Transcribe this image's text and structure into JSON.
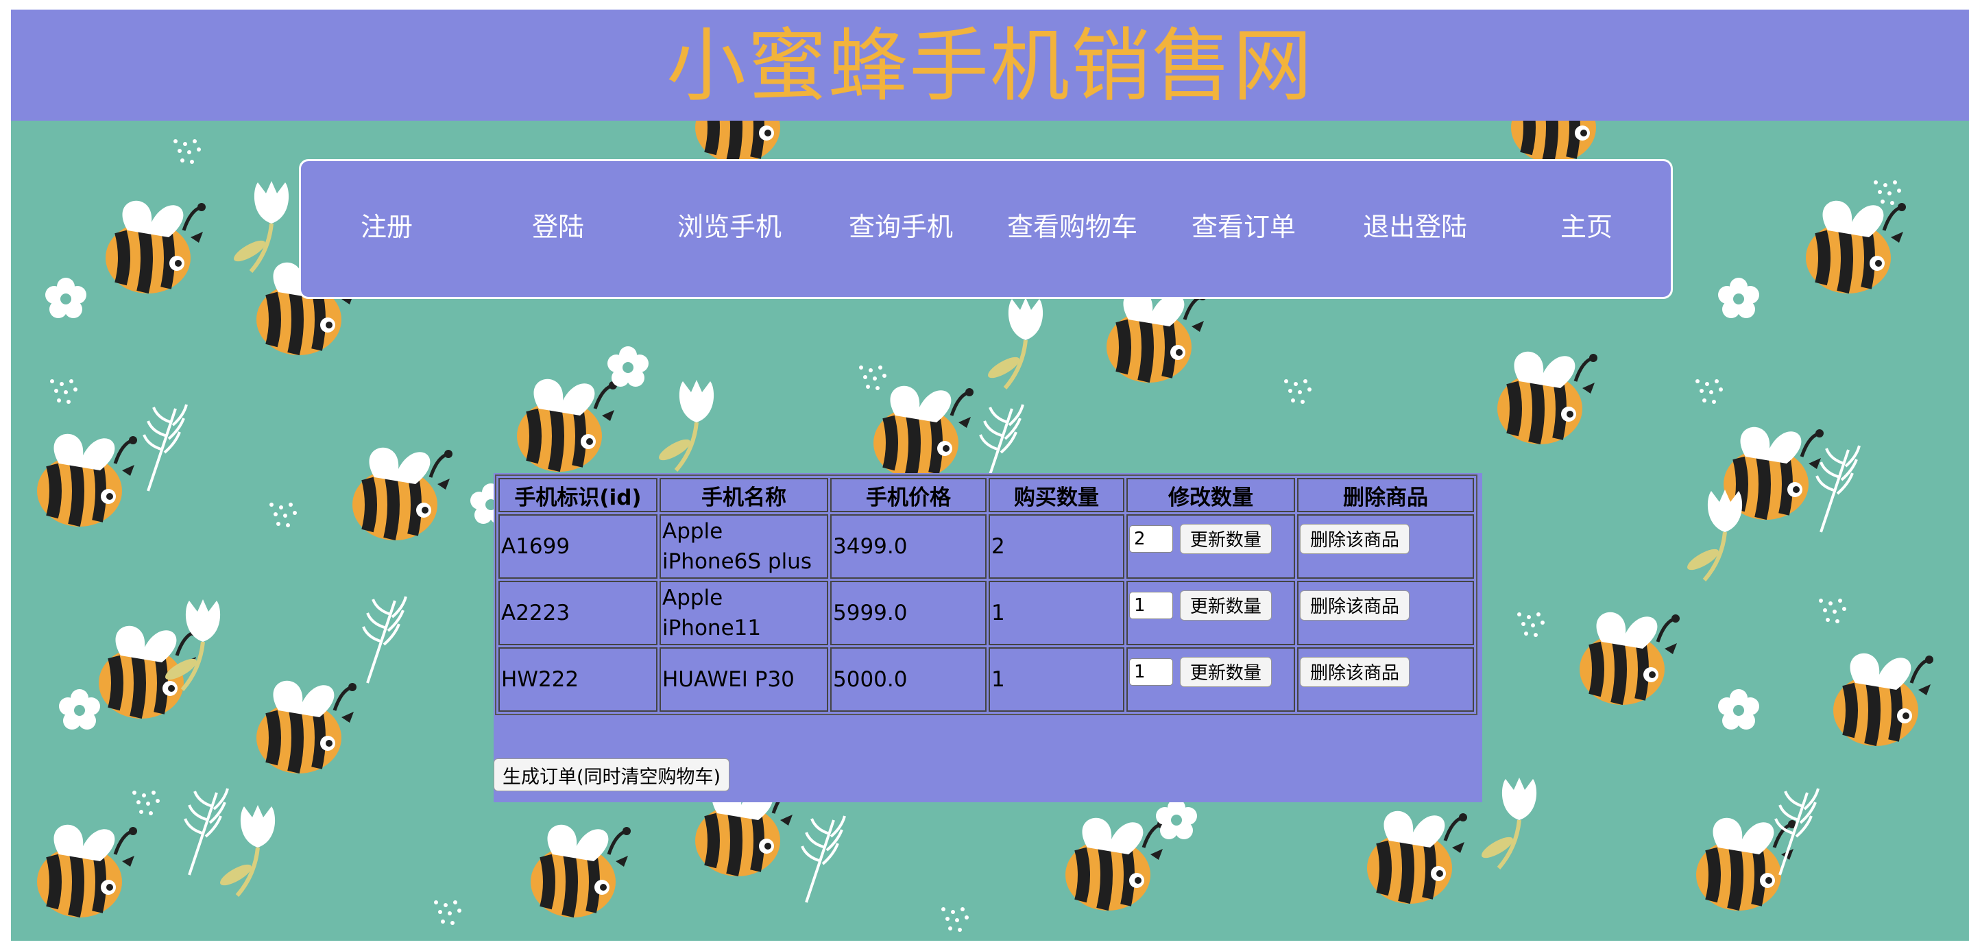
{
  "header": {
    "title": "小蜜蜂手机销售网"
  },
  "nav": {
    "items": [
      "注册",
      "登陆",
      "浏览手机",
      "查询手机",
      "查看购物车",
      "查看订单",
      "退出登陆",
      "主页"
    ]
  },
  "cart": {
    "headers": [
      "手机标识(id)",
      "手机名称",
      "手机价格",
      "购买数量",
      "修改数量",
      "删除商品"
    ],
    "rows": [
      {
        "id": "A1699",
        "name": "Apple iPhone6S plus",
        "price": "3499.0",
        "quantity": "2",
        "qty_input": "2",
        "update_label": "更新数量",
        "delete_label": "删除该商品"
      },
      {
        "id": "A2223",
        "name": "Apple iPhone11",
        "price": "5999.0",
        "quantity": "1",
        "qty_input": "1",
        "update_label": "更新数量",
        "delete_label": "删除该商品"
      },
      {
        "id": "HW222",
        "name": "HUAWEI P30",
        "price": "5000.0",
        "quantity": "1",
        "qty_input": "1",
        "update_label": "更新数量",
        "delete_label": "删除该商品"
      }
    ],
    "create_order_label": "生成订单(同时清空购物车)"
  },
  "colors": {
    "banner": "#8488de",
    "title": "#f2b33c",
    "background": "#6fbba9",
    "bee_yellow": "#f0a63a",
    "bee_black": "#1f1f1f"
  }
}
